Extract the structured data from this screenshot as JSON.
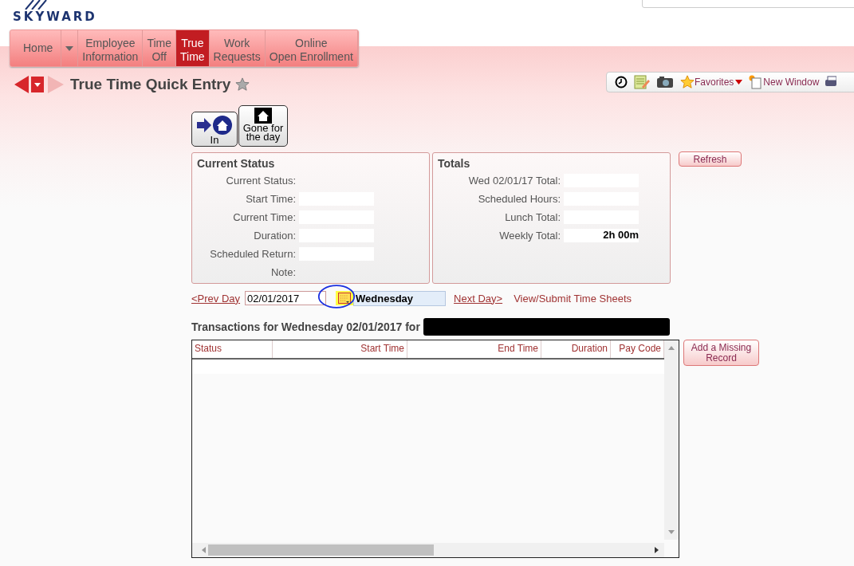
{
  "header": {
    "logo": "SKYWARD"
  },
  "nav": {
    "tabs": [
      {
        "label": "Home",
        "selected": false
      },
      {
        "label": "Employee\nInformation",
        "selected": false
      },
      {
        "label": "Time\nOff",
        "selected": false
      },
      {
        "label": "True\nTime",
        "selected": true
      },
      {
        "label": "Work\nRequests",
        "selected": false
      },
      {
        "label": "Online\nOpen Enrollment",
        "selected": false
      }
    ]
  },
  "page": {
    "title": "True Time Quick Entry"
  },
  "toolbar": {
    "favorites": "Favorites",
    "new_window": "New Window"
  },
  "clock_buttons": [
    {
      "label": "In",
      "kind": "in"
    },
    {
      "label": "Gone for\nthe day",
      "kind": "gone"
    }
  ],
  "current_status": {
    "title": "Current Status",
    "fields": [
      {
        "label": "Current Status:",
        "kind": "text"
      },
      {
        "label": "Start Time:",
        "kind": "box"
      },
      {
        "label": "Current Time:",
        "kind": "box"
      },
      {
        "label": "Duration:",
        "kind": "box"
      },
      {
        "label": "Scheduled Return:",
        "kind": "box"
      },
      {
        "label": "Note:",
        "kind": "text"
      }
    ]
  },
  "totals": {
    "title": "Totals",
    "fields": [
      {
        "label": "Wed 02/01/17 Total:"
      },
      {
        "label": "Scheduled Hours:"
      },
      {
        "label": "Lunch Total:"
      },
      {
        "label": "Weekly Total:",
        "value": "2h 00m"
      }
    ]
  },
  "refresh_button": "Refresh",
  "date_nav": {
    "prev": "<Prev Day",
    "date": "02/01/2017",
    "day": "Wednesday",
    "next": "Next Day>",
    "view": "View/Submit Time Sheets"
  },
  "transactions": {
    "heading": "Transactions for Wednesday 02/01/2017 for",
    "columns": [
      "Status",
      "Start Time",
      "End Time",
      "Duration",
      "Pay Code"
    ]
  },
  "add_button": "Add a Missing\nRecord"
}
